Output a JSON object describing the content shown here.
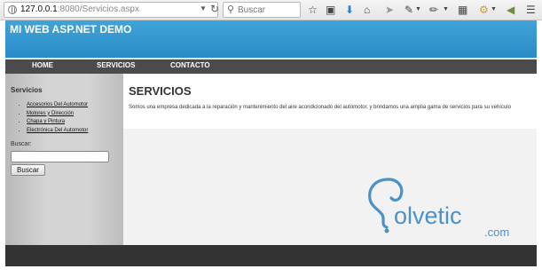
{
  "browser": {
    "url_host": "127.0.0.1",
    "url_rest": ":8080/Servicios.aspx",
    "search_placeholder": "Buscar"
  },
  "site": {
    "title": "MI WEB ASP.NET DEMO",
    "nav": [
      {
        "label": "HOME"
      },
      {
        "label": "SERVICIOS"
      },
      {
        "label": "CONTACTO"
      }
    ]
  },
  "sidebar": {
    "title": "Servicios",
    "items": [
      {
        "label": "Accesorios Del Automotor"
      },
      {
        "label": "Motores y Dirección"
      },
      {
        "label": "Chapa y Pintura"
      },
      {
        "label": "Electrónica Del Automotor"
      }
    ],
    "search_label": "Buscar:",
    "search_value": "",
    "search_button": "Buscar"
  },
  "content": {
    "heading": "SERVICIOS",
    "text": "Somos una empresa dedicada a la reparación y mantenimiento del aire acondicionado del automotor, y brindamos una amplia gama de servicios para su vehículo"
  },
  "watermark": {
    "text": "olvetic",
    "suffix": ".com"
  },
  "colors": {
    "header_blue": "#2a8bc6",
    "nav_dark": "#4b4b4b",
    "footer": "#333333",
    "watermark": "#4b92c6"
  }
}
